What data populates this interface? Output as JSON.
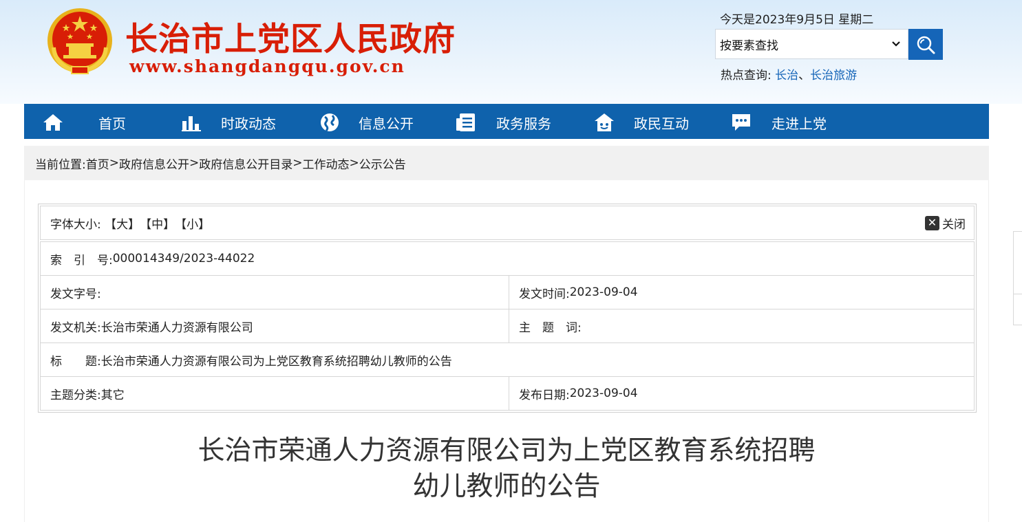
{
  "header": {
    "site_title": "长治市上党区人民政府",
    "site_url": "www.shangdangqu.gov.cn",
    "date_text": "今天是2023年9月5日 星期二",
    "search": {
      "selected": "按要素查找",
      "button_icon": "search-icon"
    },
    "hot": {
      "label": "热点查询:",
      "links": [
        "长治",
        "长治旅游"
      ],
      "separator": "、"
    },
    "colors": {
      "title_red": "#d81e06",
      "brand_blue": "#0f62ac"
    }
  },
  "nav": {
    "items": [
      {
        "label": "首页",
        "icon": "home-icon"
      },
      {
        "label": "时政动态",
        "icon": "bar-chart-icon"
      },
      {
        "label": "信息公开",
        "icon": "globe-icon"
      },
      {
        "label": "政务服务",
        "icon": "document-icon"
      },
      {
        "label": "政民互动",
        "icon": "user-house-icon"
      },
      {
        "label": "走进上党",
        "icon": "chat-icon"
      }
    ]
  },
  "breadcrumb": {
    "label": "当前位置:",
    "items": [
      "首页",
      "政府信息公开",
      "政府信息公开目录",
      "工作动态",
      "公示公告"
    ],
    "separator": ">"
  },
  "info": {
    "font_size_label": "字体大小:",
    "font_sizes": [
      "【大】",
      "【中】",
      "【小】"
    ],
    "close_label": "关闭",
    "index_label": "索　引　号:",
    "index_value": "000014349/2023-44022",
    "doc_no_label": "发文字号:",
    "doc_no_value": "",
    "issue_time_label": "发文时间:",
    "issue_time_value": "2023-09-04",
    "issuer_label": "发文机关:",
    "issuer_value": "长治市荣通人力资源有限公司",
    "keywords_label": "主　题　词:",
    "keywords_value": "",
    "title_label": "标　　题:",
    "title_value": "长治市荣通人力资源有限公司为上党区教育系统招聘幼儿教师的公告",
    "category_label": "主题分类:",
    "category_value": "其它",
    "publish_date_label": "发布日期:",
    "publish_date_value": "2023-09-04"
  },
  "article": {
    "title_line1": "长治市荣通人力资源有限公司为上党区教育系统招聘",
    "title_line2": "幼儿教师的公告"
  }
}
